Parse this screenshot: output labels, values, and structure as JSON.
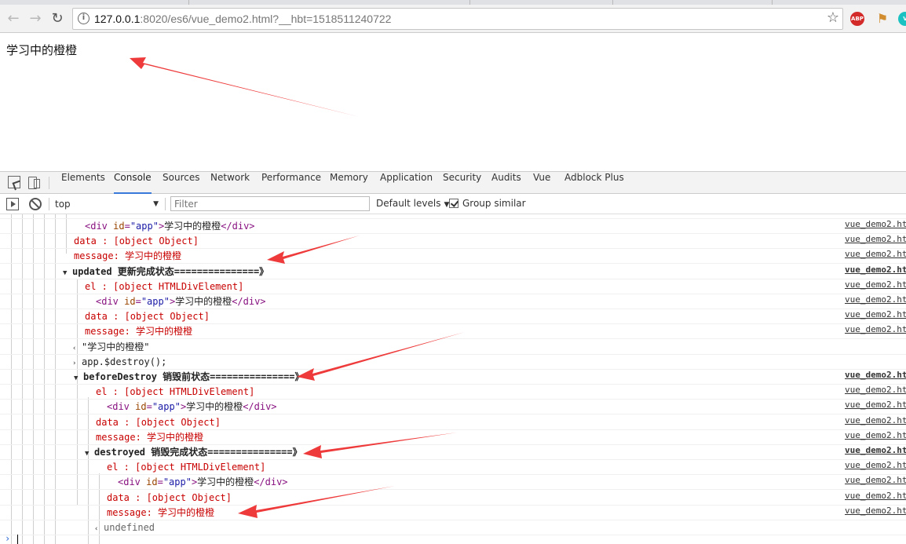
{
  "browser": {
    "url_host": "127.0.0.1",
    "url_rest": ":8020/es6/vue_demo2.html?__hbt=1518511240722",
    "extensions": {
      "abp": "ABP",
      "vue": "V"
    }
  },
  "page": {
    "text": "学习中的橙橙"
  },
  "devtools": {
    "tabs": [
      "Elements",
      "Console",
      "Sources",
      "Network",
      "Performance",
      "Memory",
      "Application",
      "Security",
      "Audits",
      "Vue",
      "Adblock Plus"
    ],
    "selected_tab": "Console",
    "console": {
      "context": "top",
      "filter_placeholder": "Filter",
      "levels": "Default levels",
      "group_similar": "Group similar"
    }
  },
  "log": {
    "src": "vue_demo2.html",
    "rows": [
      {
        "kind": "div",
        "indent": 108,
        "div_text": "学习中的橙橙"
      },
      {
        "kind": "red",
        "indent": 94,
        "text": "data   : [object Object]"
      },
      {
        "kind": "red",
        "indent": 94,
        "text": "message: 学习中的橙橙"
      },
      {
        "kind": "head",
        "indent": 80,
        "text": "updated 更新完成状态===============》"
      },
      {
        "kind": "red",
        "indent": 108,
        "text": "el     : [object HTMLDivElement]"
      },
      {
        "kind": "div",
        "indent": 122,
        "div_text": "学习中的橙橙"
      },
      {
        "kind": "red",
        "indent": 108,
        "text": "data   : [object Object]"
      },
      {
        "kind": "red",
        "indent": 108,
        "text": "message: 学习中的橙橙"
      },
      {
        "kind": "result",
        "indent": 92,
        "text": "\"学习中的橙橙\""
      },
      {
        "kind": "input",
        "indent": 92,
        "text": "app.$destroy();"
      },
      {
        "kind": "head",
        "indent": 94,
        "text": "beforeDestroy 销毁前状态===============》"
      },
      {
        "kind": "red",
        "indent": 122,
        "text": "el     : [object HTMLDivElement]"
      },
      {
        "kind": "div",
        "indent": 136,
        "div_text": "学习中的橙橙"
      },
      {
        "kind": "red",
        "indent": 122,
        "text": "data   : [object Object]"
      },
      {
        "kind": "red",
        "indent": 122,
        "text": "message: 学习中的橙橙"
      },
      {
        "kind": "head",
        "indent": 108,
        "text": "destroyed 销毁完成状态===============》"
      },
      {
        "kind": "red",
        "indent": 136,
        "text": "el     : [object HTMLDivElement]"
      },
      {
        "kind": "div",
        "indent": 150,
        "div_text": "学习中的橙橙"
      },
      {
        "kind": "red",
        "indent": 136,
        "text": "data   : [object Object]"
      },
      {
        "kind": "red",
        "indent": 136,
        "text": "message: 学习中的橙橙"
      },
      {
        "kind": "result",
        "indent": 120,
        "text": "undefined"
      }
    ]
  },
  "colors": {
    "arrow": "#ee3a3a",
    "log_red": "#c80000",
    "tab_accent": "#3879d9"
  }
}
